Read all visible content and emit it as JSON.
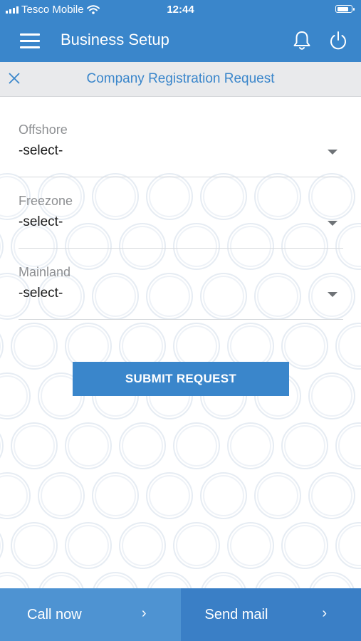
{
  "status_bar": {
    "carrier": "Tesco Mobile",
    "time": "12:44"
  },
  "header": {
    "title": "Business Setup",
    "icons": [
      "menu-icon",
      "bell-icon",
      "power-icon"
    ]
  },
  "subheader": {
    "title": "Company Registration Request",
    "close_icon": "close-icon"
  },
  "form": {
    "fields": [
      {
        "label": "Offshore",
        "value": "-select-"
      },
      {
        "label": "Freezone",
        "value": "-select-"
      },
      {
        "label": "Mainland",
        "value": "-select-"
      }
    ],
    "submit_label": "SUBMIT REQUEST"
  },
  "footer": {
    "call_label": "Call now",
    "mail_label": "Send mail",
    "chevron": "›"
  },
  "colors": {
    "primary": "#3a86cb",
    "call_button": "#4e93d2",
    "mail_button": "#3a7fc6",
    "subheader_bg": "#e9eaec"
  }
}
